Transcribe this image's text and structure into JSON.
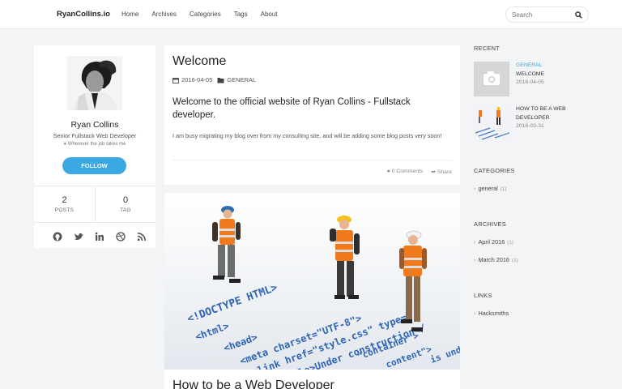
{
  "header": {
    "brand": "RyanCollins.io",
    "nav": [
      "Home",
      "Archives",
      "Categories",
      "Tags",
      "About"
    ],
    "search_placeholder": "Search"
  },
  "profile": {
    "name": "Ryan Collins",
    "title": "Senior Fullstack Web Developer",
    "location": "Wherever the job takes me",
    "follow_label": "FOLLOW",
    "posts_count": "2",
    "posts_label": "POSTS",
    "tag_count": "0",
    "tag_label": "TAG",
    "social_icons": [
      "github-icon",
      "twitter-icon",
      "linkedin-icon",
      "dribbble-icon",
      "rss-icon"
    ]
  },
  "posts": [
    {
      "title": "Welcome",
      "date": "2016-04-05",
      "category": "GENERAL",
      "subtitle": "Welcome to the official website of Ryan Collins - Fullstack developer.",
      "body": "I am busy migrating my blog over from my consulting site, and will be adding some blog posts very soon!",
      "comments": "0 Comments",
      "share": "Share"
    },
    {
      "title": "How to be a Web Developer",
      "hero_code": [
        "<!DOCTYPE HTML>",
        "<html>",
        "<head>",
        "<meta charset=\"UTF-8\">",
        "<link href=\"style.css\" type=\"",
        "<title>Under construction</",
        "\"container\">",
        "content\">",
        "is under"
      ]
    }
  ],
  "sidebar": {
    "recent_heading": "RECENT",
    "recent": [
      {
        "category": "GENERAL",
        "title": "WELCOME",
        "date": "2016-04-05"
      },
      {
        "title": "HOW TO BE A WEB DEVELOPER",
        "date": "2016-03-31"
      }
    ],
    "categories_heading": "CATEGORIES",
    "categories": [
      {
        "name": "general",
        "count": "(1)"
      }
    ],
    "archives_heading": "ARCHIVES",
    "archives": [
      {
        "name": "April 2016",
        "count": "(1)"
      },
      {
        "name": "March 2016",
        "count": "(1)"
      }
    ],
    "links_heading": "LINKS",
    "links": [
      {
        "name": "Hacksmiths"
      }
    ]
  },
  "colors": {
    "accent": "#3ba7e3",
    "category": "#4aa3d8",
    "background": "#f2f4f5"
  }
}
